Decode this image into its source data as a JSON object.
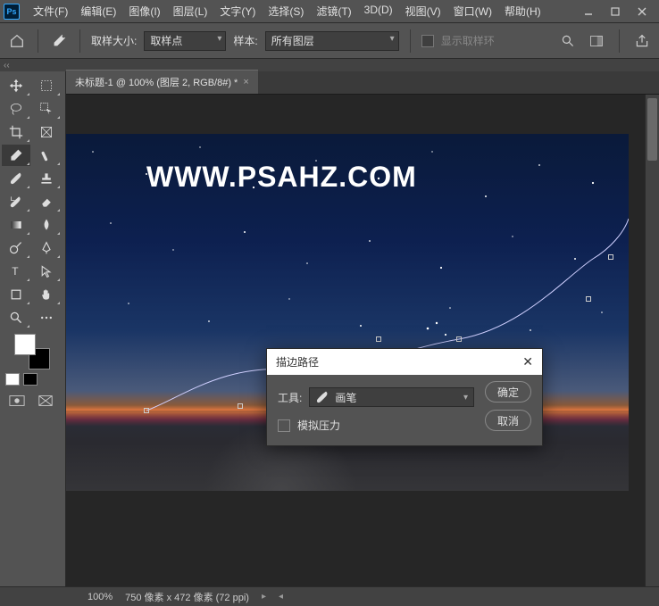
{
  "app": {
    "logo": "Ps"
  },
  "menu": [
    "文件(F)",
    "编辑(E)",
    "图像(I)",
    "图层(L)",
    "文字(Y)",
    "选择(S)",
    "滤镜(T)",
    "3D(D)",
    "视图(V)",
    "窗口(W)",
    "帮助(H)"
  ],
  "options": {
    "sample_size_label": "取样大小:",
    "sample_size_value": "取样点",
    "sample_label": "样本:",
    "sample_value": "所有图层",
    "show_ring": "显示取样环"
  },
  "doc_tab": {
    "title": "未标题-1 @ 100% (图层 2, RGB/8#) *"
  },
  "canvas": {
    "watermark": "WWW.PSAHZ.COM"
  },
  "dialog": {
    "title": "描边路径",
    "tool_label": "工具:",
    "tool_value": "画笔",
    "simulate": "模拟压力",
    "ok": "确定",
    "cancel": "取消"
  },
  "status": {
    "zoom": "100%",
    "info": "750 像素 x 472 像素 (72 ppi)"
  }
}
